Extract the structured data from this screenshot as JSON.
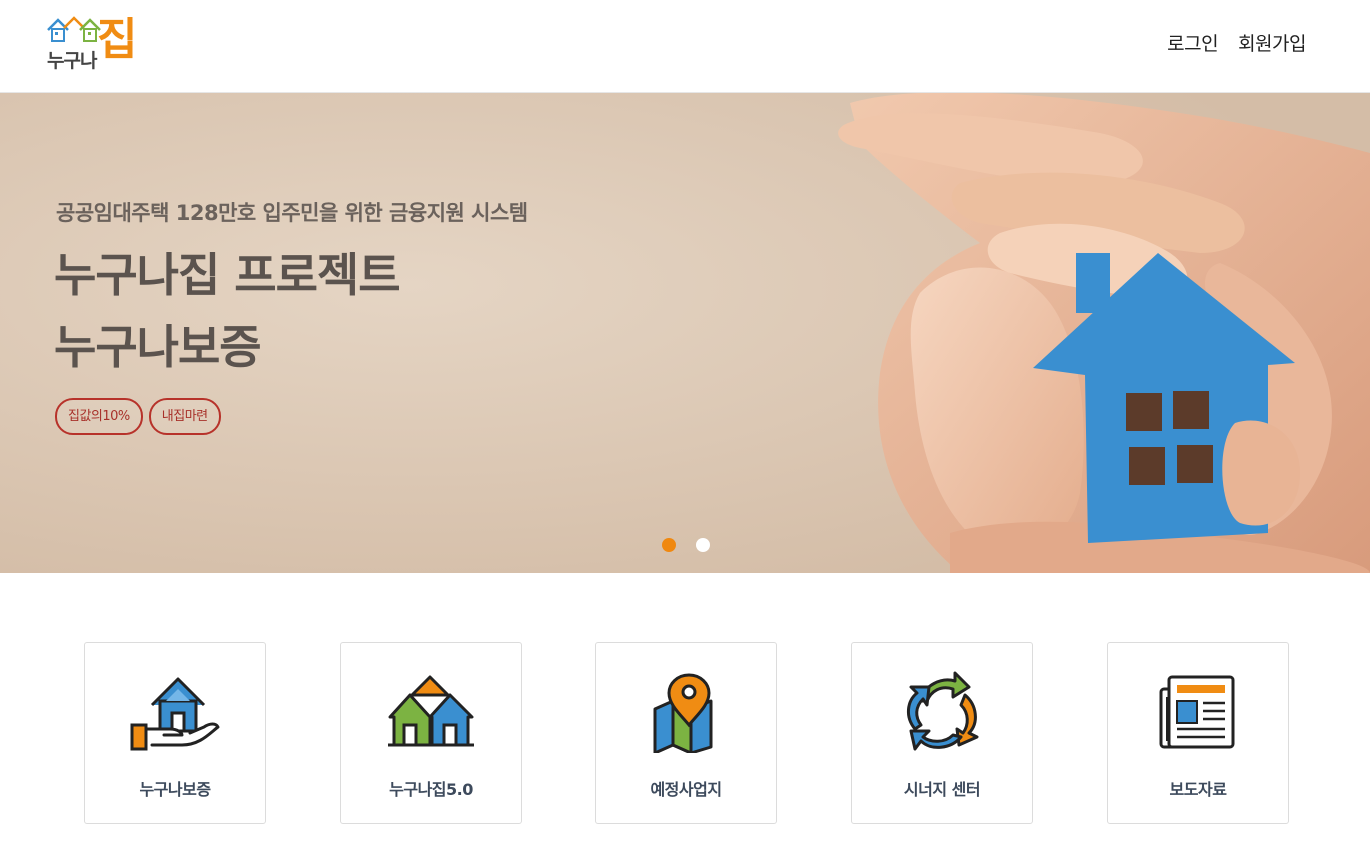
{
  "header": {
    "logo_small": "누구나",
    "logo_big": "집",
    "nav": {
      "login": "로그인",
      "signup": "회원가입"
    }
  },
  "hero": {
    "subtitle": "공공임대주택 128만호 입주민을 위한 금융지원 시스템",
    "title_line1": "누구나집 프로젝트",
    "title_line2": "누구나보증",
    "tags": [
      "집값의10%",
      "내집마련"
    ],
    "slides_total": 2,
    "active_slide": 1
  },
  "services": [
    {
      "label": "누구나보증",
      "icon": "hand-house-icon"
    },
    {
      "label": "누구나집5.0",
      "icon": "houses-icon"
    },
    {
      "label": "예정사업지",
      "icon": "map-pin-icon"
    },
    {
      "label": "시너지 센터",
      "icon": "recycle-arrows-icon"
    },
    {
      "label": "보도자료",
      "icon": "newspaper-icon"
    }
  ],
  "colors": {
    "accent": "#f0880f",
    "tag_border": "#b7322a",
    "house_blue": "#3a8fd0"
  }
}
